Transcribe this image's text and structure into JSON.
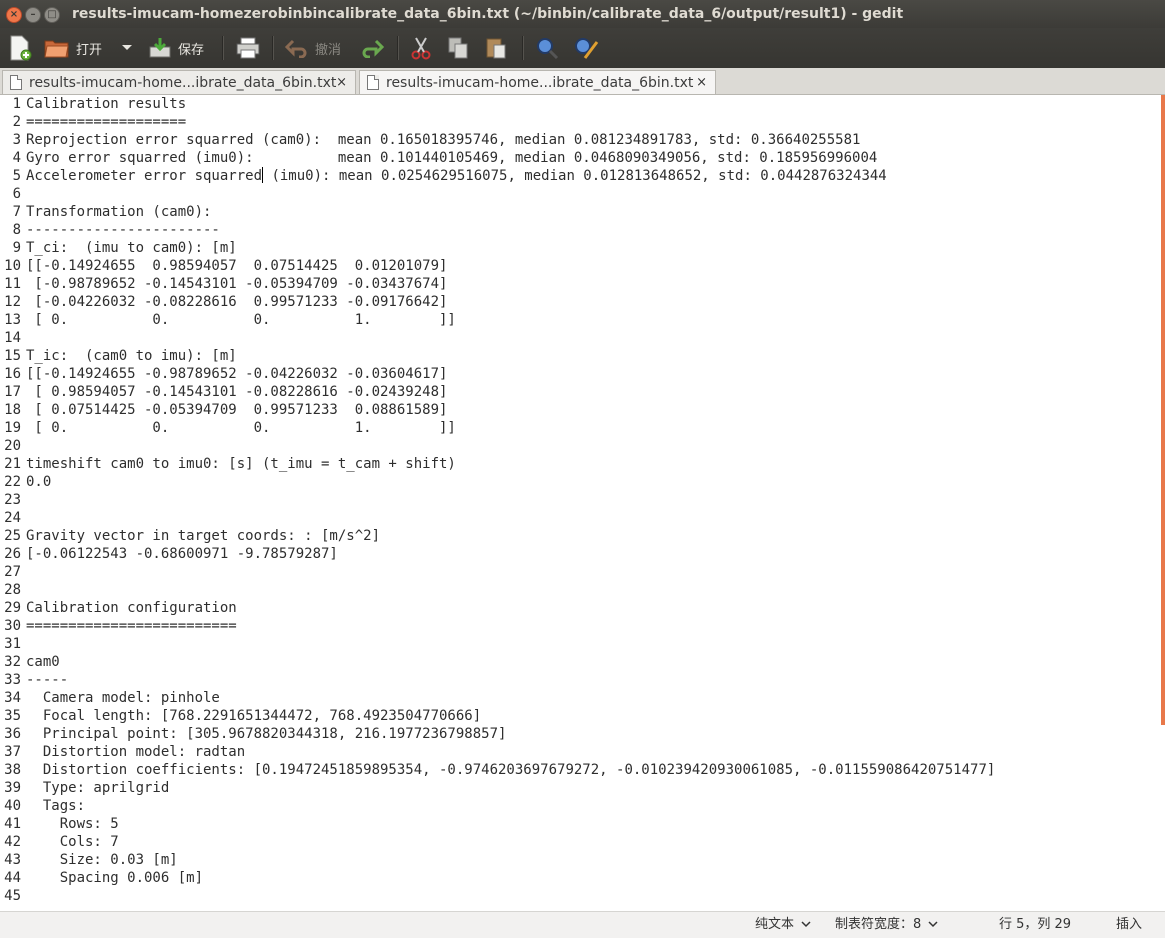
{
  "window": {
    "title": "results-imucam-homezerobinbincalibrate_data_6bin.txt (~/binbin/calibrate_data_6/output/result1) - gedit"
  },
  "toolbar": {
    "new_icon": "new-document-icon",
    "open_label": "打开",
    "save_label": "保存",
    "undo_label": "撤消",
    "print_icon": "print-icon",
    "redo_icon": "redo-icon",
    "cut_icon": "cut-icon",
    "copy_icon": "copy-icon",
    "paste_icon": "paste-icon",
    "find_icon": "find-icon",
    "replace_icon": "find-replace-icon"
  },
  "tabs": [
    {
      "label": "results-imucam-home...ibrate_data_6bin.txt",
      "close": "×"
    },
    {
      "label": "results-imucam-home...ibrate_data_6bin.txt",
      "close": "×"
    }
  ],
  "editor": {
    "line_numbers": [
      "1",
      "2",
      "3",
      "4",
      "5",
      "6",
      "7",
      "8",
      "9",
      "10",
      "11",
      "12",
      "13",
      "14",
      "15",
      "16",
      "17",
      "18",
      "19",
      "20",
      "21",
      "22",
      "23",
      "24",
      "25",
      "26",
      "27",
      "28",
      "29",
      "30",
      "31",
      "32",
      "33",
      "34",
      "35",
      "36",
      "37",
      "38",
      "39",
      "40",
      "41",
      "42",
      "43",
      "44",
      "45"
    ],
    "lines": [
      "Calibration results",
      "===================",
      "Reprojection error squarred (cam0):  mean 0.165018395746, median 0.081234891783, std: 0.36640255581",
      "Gyro error squarred (imu0):          mean 0.101440105469, median 0.0468090349056, std: 0.185956996004",
      "Accelerometer error squarred (imu0): mean 0.0254629516075, median 0.012813648652, std: 0.0442876324344",
      "",
      "Transformation (cam0):",
      "-----------------------",
      "T_ci:  (imu to cam0): [m]",
      "[[-0.14924655  0.98594057  0.07514425  0.01201079]",
      " [-0.98789652 -0.14543101 -0.05394709 -0.03437674]",
      " [-0.04226032 -0.08228616  0.99571233 -0.09176642]",
      " [ 0.          0.          0.          1.        ]]",
      "",
      "T_ic:  (cam0 to imu): [m]",
      "[[-0.14924655 -0.98789652 -0.04226032 -0.03604617]",
      " [ 0.98594057 -0.14543101 -0.08228616 -0.02439248]",
      " [ 0.07514425 -0.05394709  0.99571233  0.08861589]",
      " [ 0.          0.          0.          1.        ]]",
      "",
      "timeshift cam0 to imu0: [s] (t_imu = t_cam + shift)",
      "0.0",
      "",
      "",
      "Gravity vector in target coords: : [m/s^2]",
      "[-0.06122543 -0.68600971 -9.78579287]",
      "",
      "",
      "Calibration configuration",
      "=========================",
      "",
      "cam0",
      "-----",
      "  Camera model: pinhole",
      "  Focal length: [768.2291651344472, 768.4923504770666]",
      "  Principal point: [305.9678820344318, 216.1977236798857]",
      "  Distortion model: radtan",
      "  Distortion coefficients: [0.19472451859895354, -0.9746203697679272, -0.010239420930061085, -0.011559086420751477]",
      "  Type: aprilgrid",
      "  Tags:",
      "    Rows: 5",
      "    Cols: 7",
      "    Size: 0.03 [m]",
      "    Spacing 0.006 [m]",
      ""
    ],
    "line5_before_cursor": "Accelerometer error squarred",
    "line5_after_cursor": " (imu0): mean 0.0254629516075, median 0.012813648652, std: 0.0442876324344"
  },
  "statusbar": {
    "mode": "纯文本",
    "tab_width": "制表符宽度：8",
    "position": "行 5，列 29",
    "insert": "插入"
  },
  "colors": {
    "accent": "#e8784a",
    "titlebar": "#3c3b37"
  }
}
